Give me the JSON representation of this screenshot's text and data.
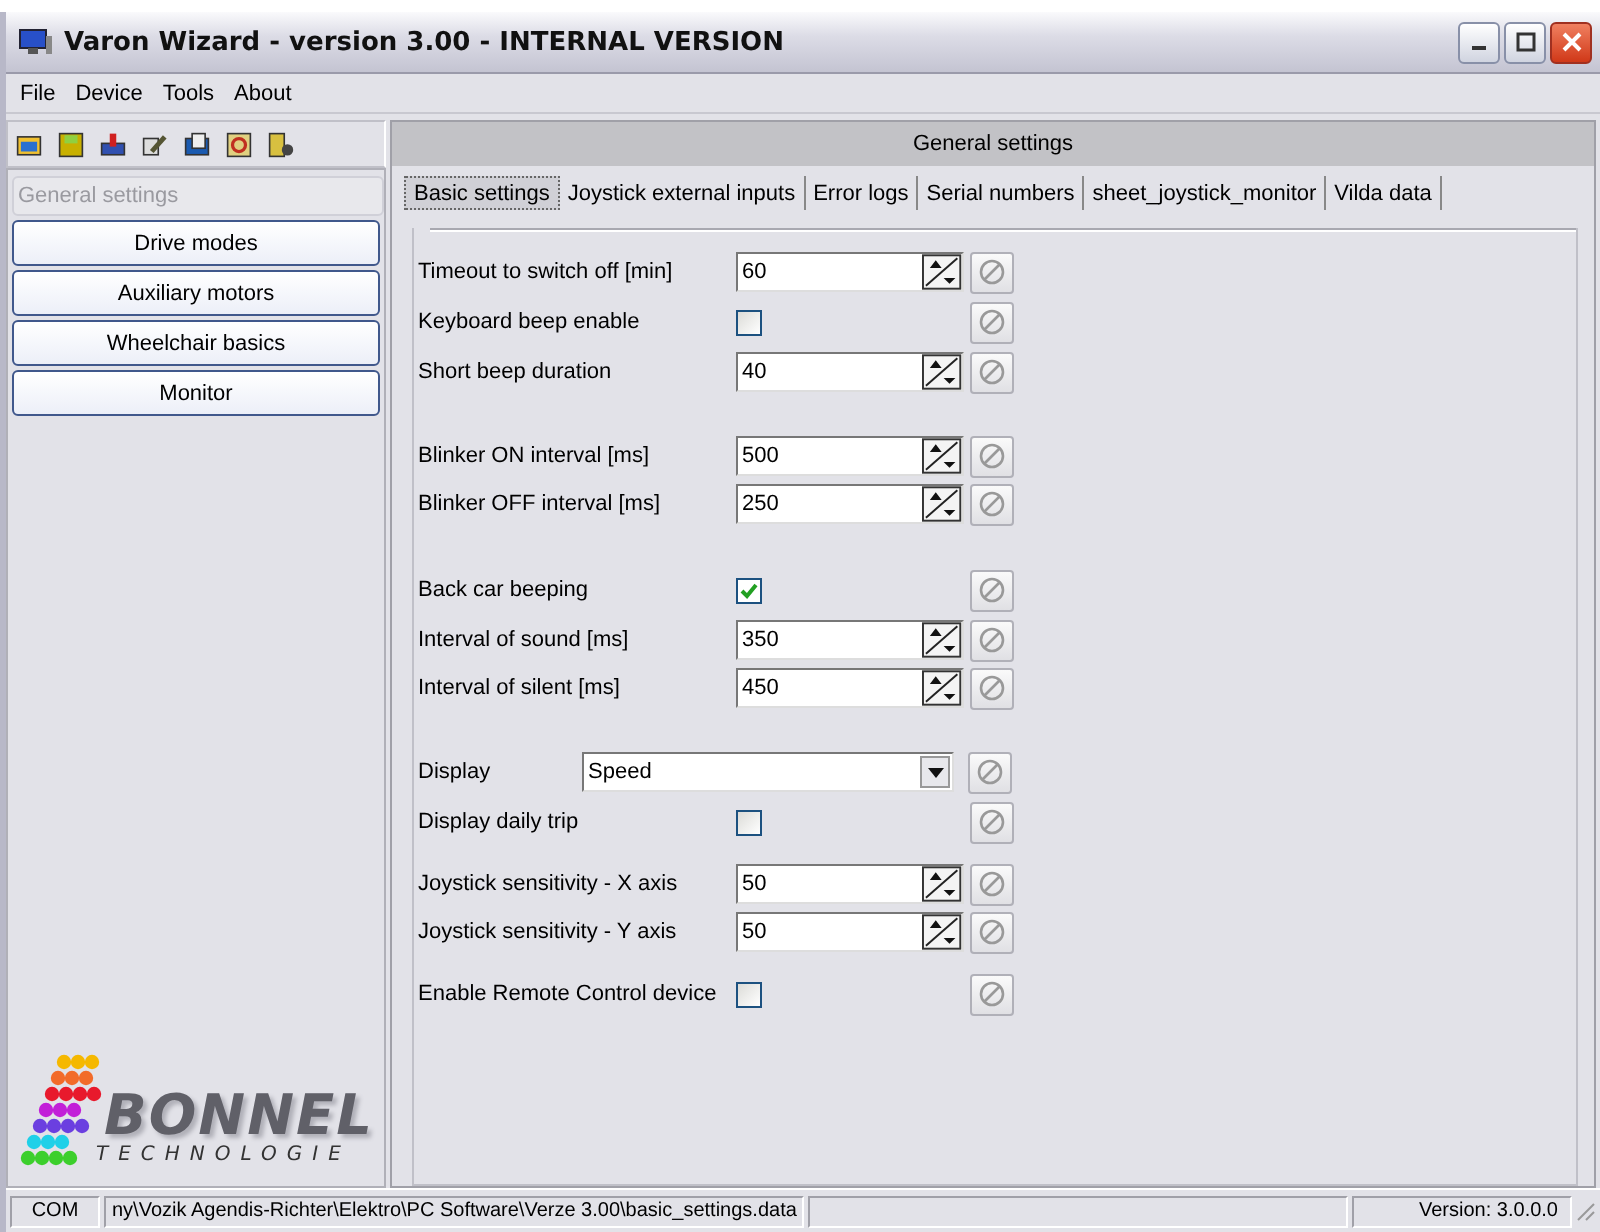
{
  "window": {
    "title": "Varon Wizard - version 3.00 - INTERNAL VERSION"
  },
  "menu": [
    "File",
    "Device",
    "Tools",
    "About"
  ],
  "sidebar": {
    "items": [
      {
        "label": "General settings",
        "selected": true
      },
      {
        "label": "Drive modes",
        "selected": false
      },
      {
        "label": "Auxiliary motors",
        "selected": false
      },
      {
        "label": "Wheelchair basics",
        "selected": false
      },
      {
        "label": "Monitor",
        "selected": false
      }
    ]
  },
  "logo": {
    "name": "BONNEL",
    "tagline": "TECHNOLOGIE"
  },
  "panel": {
    "title": "General settings"
  },
  "tabs": [
    {
      "label": "Basic settings",
      "selected": true
    },
    {
      "label": "Joystick external inputs",
      "selected": false
    },
    {
      "label": "Error logs",
      "selected": false
    },
    {
      "label": "Serial numbers",
      "selected": false
    },
    {
      "label": "sheet_joystick_monitor",
      "selected": false
    },
    {
      "label": "Vilda data",
      "selected": false
    }
  ],
  "groups": [
    {
      "rows": [
        {
          "kind": "spin",
          "label": "Timeout to switch off [min]",
          "value": "60"
        },
        {
          "kind": "check",
          "label": "Keyboard beep enable",
          "checked": false
        },
        {
          "kind": "spin",
          "label": "Short beep duration",
          "value": "40"
        }
      ]
    },
    {
      "rows": [
        {
          "kind": "spin",
          "label": "Blinker ON interval [ms]",
          "value": "500"
        },
        {
          "kind": "spin",
          "label": "Blinker OFF interval [ms]",
          "value": "250"
        }
      ]
    },
    {
      "rows": [
        {
          "kind": "check",
          "label": "Back car beeping",
          "checked": true
        },
        {
          "kind": "spin",
          "label": "Interval of sound [ms]",
          "value": "350"
        },
        {
          "kind": "spin",
          "label": "Interval of silent [ms]",
          "value": "450"
        }
      ]
    },
    {
      "rows": [
        {
          "kind": "select",
          "label": "Display",
          "value": "Speed"
        },
        {
          "kind": "check",
          "label": "Display daily trip",
          "checked": false
        }
      ]
    },
    {
      "rows": [
        {
          "kind": "spin",
          "label": "Joystick sensitivity - X axis",
          "value": "50"
        },
        {
          "kind": "spin",
          "label": "Joystick sensitivity - Y axis",
          "value": "50"
        }
      ]
    },
    {
      "rows": [
        {
          "kind": "check",
          "label": "Enable Remote Control device",
          "checked": false
        }
      ]
    }
  ],
  "status_bar": {
    "port": "COM",
    "path": "ny\\Vozik Agendis-Richter\\Elektro\\PC Software\\Verze 3.00\\basic_settings.data",
    "version": "Version: 3.0.0.0"
  }
}
